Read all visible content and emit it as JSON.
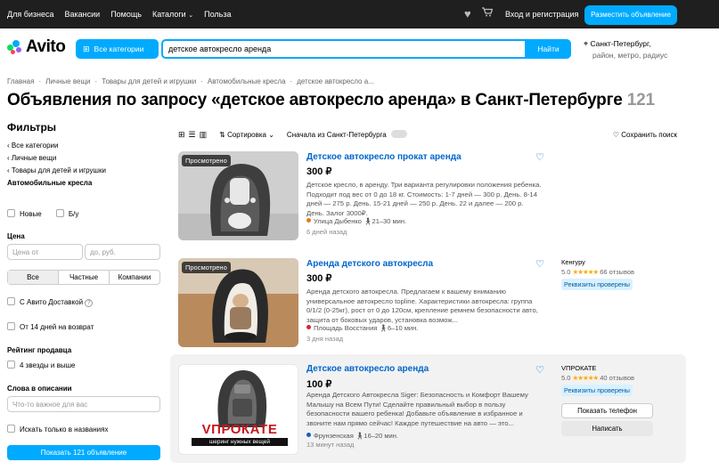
{
  "topbar": {
    "links": [
      "Для бизнеса",
      "Вакансии",
      "Помощь",
      "Каталоги",
      "Польза"
    ],
    "login": "Вход и регистрация",
    "post_button": "Разместить объявление"
  },
  "header": {
    "logo": "Avito",
    "categories_button": "Все категории",
    "search_value": "детское автокресло аренда",
    "find_button": "Найти",
    "location": "Санкт-Петербург,",
    "location_sub": "район, метро, радиус"
  },
  "breadcrumbs": [
    "Главная",
    "Личные вещи",
    "Товары для детей и игрушки",
    "Автомобильные кресла",
    "детское автокресло а..."
  ],
  "page_title": "Объявления по запросу «детское автокресло аренда» в Санкт-Петербурге",
  "result_count": "121",
  "filters": {
    "title": "Фильтры",
    "cats": [
      "Все категории",
      "Личные вещи",
      "Товары для детей и игрушки"
    ],
    "current_cat": "Автомобильные кресла",
    "cond_new": "Новые",
    "cond_used": "Б/у",
    "price_label": "Цена",
    "price_from": "Цена от",
    "price_to": "до, руб.",
    "seller_types": [
      "Все",
      "Частные",
      "Компании"
    ],
    "delivery": "С Авито Доставкой",
    "return": "От 14 дней на возврат",
    "rating_label": "Рейтинг продавца",
    "rating_opt": "4 звезды и выше",
    "words_label": "Слова в описании",
    "words_placeholder": "Что-то важное для вас",
    "titles_only": "Искать только в названиях",
    "show_button": "Показать 121 объявление"
  },
  "toolbar": {
    "sort": "Сортировка",
    "from_city": "Сначала из Санкт-Петербурга",
    "save_search": "Сохранить поиск"
  },
  "listings": [
    {
      "badge": "Просмотрено",
      "title": "Детское автокресло прокат аренда",
      "price": "300 ₽",
      "description": "Детское кресло, в аренду. Три варианта регулировки положения ребенка. Подходит под вес от 0 до 18 кг. Стоимость: 1-7 дней — 300 р. День. 8-14 дней — 275 р. День. 15-21 дней — 250 р. День. 22 и далее — 200 р. День. Залог 3000₽.",
      "location": "Улица Дыбенко",
      "walk": "21–30 мин.",
      "date": "6 дней назад",
      "metro_color": "#e07c1b"
    },
    {
      "badge": "Просмотрено",
      "title": "Аренда детского автокресла",
      "price": "300 ₽",
      "description": "Аренда детского автокресла. Предлагаем к вашему вниманию универсальное автокресло topline. Характеристики автокресла: группа 0/1/2 (0-25кг), рост от 0 до 120см, крепление ремнем безопасности авто, защита от боковых ударов, установка возмож...",
      "location": "Площадь Восстания",
      "walk": "6–10 мин.",
      "date": "3 дня назад",
      "metro_color": "#d6262b",
      "seller": "Кенгуру",
      "rating": "5.0",
      "reviews": "66 отзывов",
      "verified": "Реквизиты проверены"
    },
    {
      "title": "Детское автокресло аренда",
      "price": "100 ₽",
      "description": "Аренда Детского Автокресла Siger: Безопасность и Комфорт Вашему Малышу на Всем Пути! Сделайте правильный выбор в пользу безопасности вашего ребенка! Добавьте объявление в избранное и звоните нам прямо сейчас! Каждое путешествие на авто — это...",
      "location": "Фрунзенская",
      "walk": "16–20 мин.",
      "date": "13 минут назад",
      "metro_color": "#1d5bb8",
      "seller": "VПРОКАТЕ",
      "rating": "5.0",
      "reviews": "40 отзывов",
      "verified": "Реквизиты проверены",
      "phone_button": "Показать телефон",
      "write_button": "Написать",
      "logo_main": "VПРОКАТЕ",
      "logo_sub": "шеринг нужных вещей"
    }
  ],
  "colors": {
    "accent": "#00aaff",
    "link": "#0066cc",
    "star": "#ffa800"
  }
}
